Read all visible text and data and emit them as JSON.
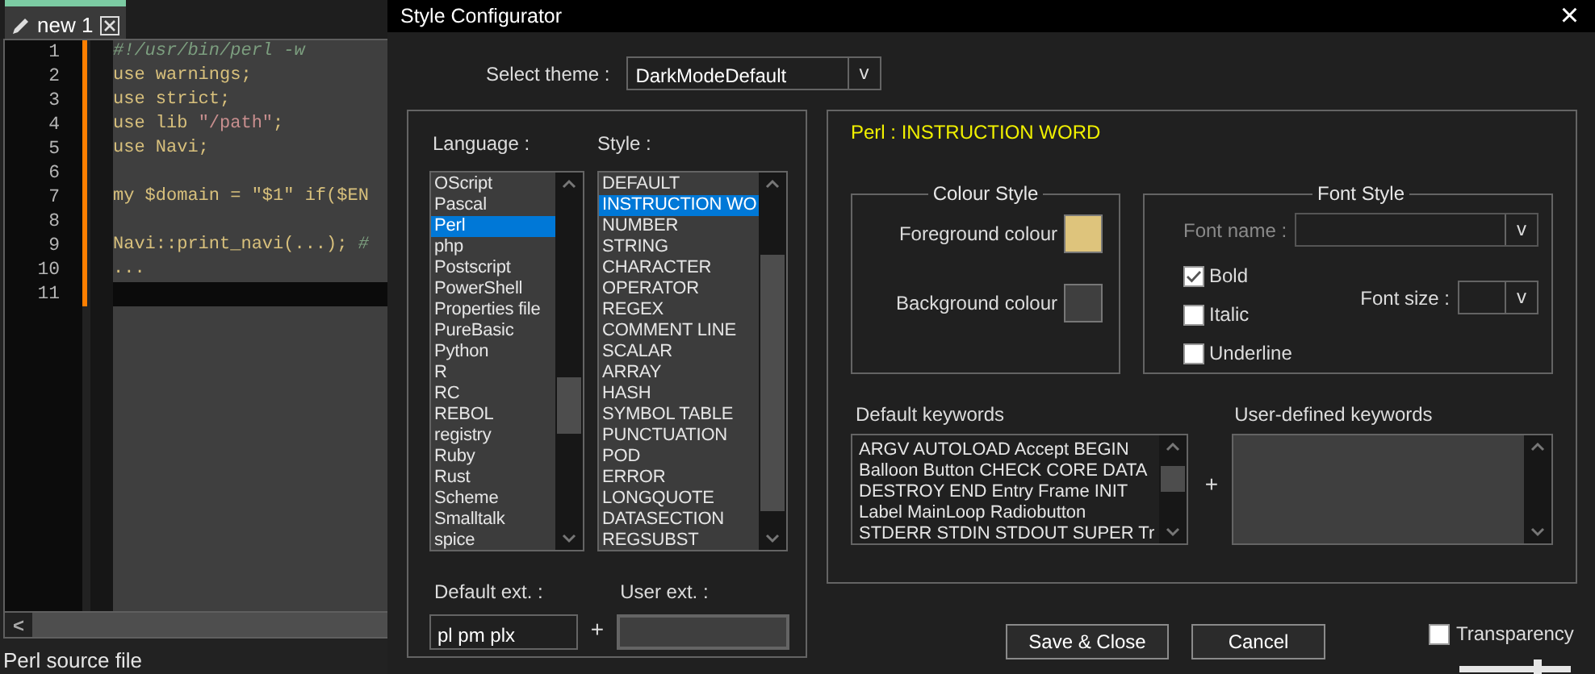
{
  "editor": {
    "tab": {
      "label": "new 1"
    },
    "lines": [
      {
        "number": "1",
        "current": false,
        "tokens": [
          {
            "text": "#!/usr/bin/perl -w",
            "kind": "comment"
          }
        ]
      },
      {
        "number": "2",
        "current": false,
        "tokens": [
          {
            "text": "use warnings;",
            "kind": "code"
          }
        ]
      },
      {
        "number": "3",
        "current": false,
        "tokens": [
          {
            "text": "use strict;",
            "kind": "code"
          }
        ]
      },
      {
        "number": "4",
        "current": false,
        "tokens": [
          {
            "text": "use lib ",
            "kind": "code"
          },
          {
            "text": "\"/path\"",
            "kind": "string"
          },
          {
            "text": ";",
            "kind": "code"
          }
        ]
      },
      {
        "number": "5",
        "current": false,
        "tokens": [
          {
            "text": "use Navi;",
            "kind": "code"
          }
        ]
      },
      {
        "number": "6",
        "current": false
      },
      {
        "number": "7",
        "current": false,
        "tokens": [
          {
            "text": "my $domain = \"$1\" if($EN",
            "kind": "code"
          }
        ]
      },
      {
        "number": "8",
        "current": false
      },
      {
        "number": "9",
        "current": false,
        "tokens": [
          {
            "text": "Navi::print_navi(...); ",
            "kind": "code"
          },
          {
            "text": "#",
            "kind": "comment"
          }
        ]
      },
      {
        "number": "10",
        "current": false,
        "tokens": [
          {
            "text": "...",
            "kind": "code"
          }
        ]
      },
      {
        "number": "11",
        "current": true
      }
    ],
    "scroll_left": "<",
    "status_bar": "Perl source file"
  },
  "dialog": {
    "title": "Style Configurator",
    "close": "×",
    "theme": {
      "label": "Select theme :",
      "value": "DarkModeDefault",
      "arrow": "v"
    },
    "language": {
      "label": "Language :",
      "items": [
        {
          "text": "OScript",
          "selected": false
        },
        {
          "text": "Pascal",
          "selected": false
        },
        {
          "text": "Perl",
          "selected": true
        },
        {
          "text": "php",
          "selected": false
        },
        {
          "text": "Postscript",
          "selected": false
        },
        {
          "text": "PowerShell",
          "selected": false
        },
        {
          "text": "Properties file",
          "selected": false
        },
        {
          "text": "PureBasic",
          "selected": false
        },
        {
          "text": "Python",
          "selected": false
        },
        {
          "text": "R",
          "selected": false
        },
        {
          "text": "RC",
          "selected": false
        },
        {
          "text": "REBOL",
          "selected": false
        },
        {
          "text": "registry",
          "selected": false
        },
        {
          "text": "Ruby",
          "selected": false
        },
        {
          "text": "Rust",
          "selected": false
        },
        {
          "text": "Scheme",
          "selected": false
        },
        {
          "text": "Smalltalk",
          "selected": false
        },
        {
          "text": "spice",
          "selected": false
        }
      ]
    },
    "style": {
      "label": "Style :",
      "items": [
        {
          "text": "DEFAULT",
          "selected": false
        },
        {
          "text": "INSTRUCTION WO",
          "selected": true
        },
        {
          "text": "NUMBER",
          "selected": false
        },
        {
          "text": "STRING",
          "selected": false
        },
        {
          "text": "CHARACTER",
          "selected": false
        },
        {
          "text": "OPERATOR",
          "selected": false
        },
        {
          "text": "REGEX",
          "selected": false
        },
        {
          "text": "COMMENT LINE",
          "selected": false
        },
        {
          "text": "SCALAR",
          "selected": false
        },
        {
          "text": "ARRAY",
          "selected": false
        },
        {
          "text": "HASH",
          "selected": false
        },
        {
          "text": "SYMBOL TABLE",
          "selected": false
        },
        {
          "text": "PUNCTUATION",
          "selected": false
        },
        {
          "text": "POD",
          "selected": false
        },
        {
          "text": "ERROR",
          "selected": false
        },
        {
          "text": "LONGQUOTE",
          "selected": false
        },
        {
          "text": "DATASECTION",
          "selected": false
        },
        {
          "text": "REGSUBST",
          "selected": false
        }
      ]
    },
    "default_ext": {
      "label": "Default ext. :",
      "value": "pl pm plx"
    },
    "ext_plus": "+",
    "user_ext": {
      "label": "User ext. :"
    },
    "heading": "Perl : INSTRUCTION WORD",
    "colour_style": {
      "legend": "Colour Style",
      "foreground": {
        "label": "Foreground colour",
        "color": "#dec47c"
      },
      "background": {
        "label": "Background colour",
        "color": "#3f3f3f"
      }
    },
    "font_style": {
      "legend": "Font Style",
      "font_name": {
        "label": "Font name :",
        "disabled": true,
        "arrow": "v"
      },
      "options": [
        {
          "label": "Bold",
          "checked": true
        },
        {
          "label": "Italic",
          "checked": false
        },
        {
          "label": "Underline",
          "checked": false
        }
      ],
      "font_size": {
        "label": "Font size :",
        "arrow": "v"
      }
    },
    "default_keywords": {
      "label": "Default keywords",
      "lines": [
        "ARGV AUTOLOAD Accept BEGIN",
        "Balloon Button CHECK CORE DATA",
        "DESTROY END Entry Frame INIT",
        "Label MainLoop Radiobutton",
        "STDERR STDIN STDOUT SUPER Tr"
      ]
    },
    "keywords_plus": "+",
    "user_keywords": {
      "label": "User-defined keywords"
    },
    "buttons": [
      "Save & Close",
      "Cancel"
    ],
    "transparency": {
      "label": "Transparency",
      "checked": false,
      "level": 0.7
    }
  }
}
